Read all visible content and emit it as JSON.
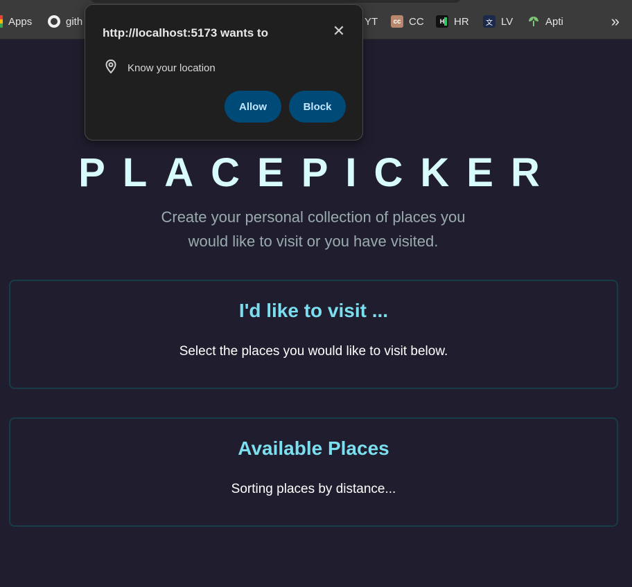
{
  "bookmarks": [
    {
      "label": "Apps",
      "icon": "apps-grid-icon"
    },
    {
      "label": "gith",
      "icon": "github-icon"
    },
    {
      "label": "YT",
      "icon": "youtube-icon"
    },
    {
      "label": "CC",
      "icon": "codechef-icon"
    },
    {
      "label": "HR",
      "icon": "hackerrank-icon"
    },
    {
      "label": "LV",
      "icon": "translate-icon"
    },
    {
      "label": "Apti",
      "icon": "leaf-icon"
    }
  ],
  "permission": {
    "origin_text": "http://localhost:5173 wants to",
    "request_label": "Know your location",
    "allow_label": "Allow",
    "block_label": "Block",
    "close_glyph": "✕"
  },
  "header": {
    "title": "PLACEPICKER",
    "subtitle": "Create your personal collection of places you would like to visit or you have visited."
  },
  "sections": [
    {
      "title": "I'd like to visit ...",
      "text": "Select the places you would like to visit below."
    },
    {
      "title": "Available Places",
      "text": "Sorting places by distance..."
    }
  ],
  "colors": {
    "background": "#201e2e",
    "accent": "#7cdff0",
    "button": "#004a77"
  }
}
